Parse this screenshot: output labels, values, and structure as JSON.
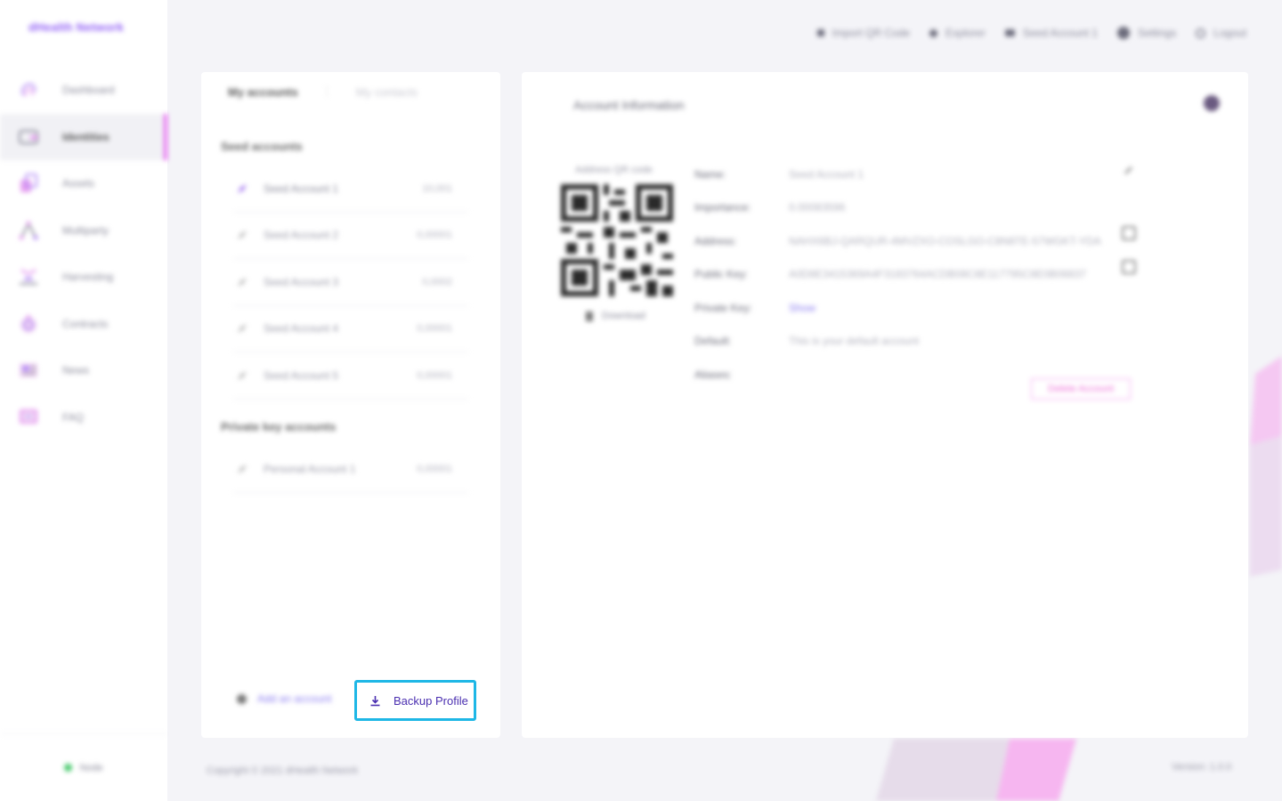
{
  "app": {
    "logo": "dHealth Network"
  },
  "sidebar": {
    "items": [
      {
        "label": "Dashboard",
        "icon": "fingerprint-icon",
        "active": false
      },
      {
        "label": "Identities",
        "icon": "wallet-icon",
        "active": true
      },
      {
        "label": "Assets",
        "icon": "assets-icon",
        "active": false
      },
      {
        "label": "Multiparty",
        "icon": "multiparty-icon",
        "active": false
      },
      {
        "label": "Harvesting",
        "icon": "harvesting-icon",
        "active": false
      },
      {
        "label": "Contracts",
        "icon": "contracts-icon",
        "active": false
      },
      {
        "label": "News",
        "icon": "news-icon",
        "active": false
      },
      {
        "label": "FAQ",
        "icon": "faq-icon",
        "active": false
      }
    ],
    "node_label": "Node"
  },
  "topbar": {
    "items": [
      {
        "label": "Import QR Code",
        "icon": "qr-import-icon"
      },
      {
        "label": "Explorer",
        "icon": "explorer-icon"
      },
      {
        "label": "Seed Account 1",
        "icon": "account-icon"
      },
      {
        "label": "Settings",
        "icon": "gear-icon"
      },
      {
        "label": "Logout",
        "icon": "logout-icon"
      }
    ]
  },
  "accounts": {
    "tab_active": "My accounts",
    "tab_separator": "⋮",
    "tab_inactive": "My contacts",
    "seed_title": "Seed accounts",
    "seed_accounts": [
      {
        "name": "Seed Account 1",
        "balance": "10,001"
      },
      {
        "name": "Seed Account 2",
        "balance": "0,00001"
      },
      {
        "name": "Seed Account 3",
        "balance": "0,0002"
      },
      {
        "name": "Seed Account 4",
        "balance": "0,00001"
      },
      {
        "name": "Seed Account 5",
        "balance": "0,00001"
      }
    ],
    "private_title": "Private key accounts",
    "private_accounts": [
      {
        "name": "Personal Account 1",
        "balance": "0,00001"
      }
    ],
    "add_account": "Add an account",
    "backup_profile": "Backup Profile"
  },
  "account_info": {
    "title": "Account Information",
    "qr_label": "Address QR code",
    "download": "Download",
    "fields": [
      {
        "label": "Name:",
        "value": "Seed Account 1"
      },
      {
        "label": "Importance:",
        "value": "0.00083596"
      },
      {
        "label": "Address:",
        "value": "NAHX6BJ-QARQUR-4MVZXO-COSLGO-C8N8TE-57WGKT-YDA"
      },
      {
        "label": "Public Key:",
        "value": "A0D8E3415369A4F3183764ACDB08C8E117795C8E0B06837"
      },
      {
        "label": "Private Key:",
        "value": "Show"
      },
      {
        "label": "Default:",
        "value": "This is your default account"
      },
      {
        "label": "Aliases:",
        "value": ""
      }
    ],
    "delete_account": "Delete Account"
  },
  "footer": {
    "copyright": "Copyright © 2021 dHealth Network",
    "version": "Version: 1.0.0"
  },
  "colors": {
    "brand": "#8f5cf5",
    "accent_pink": "#e56cf0",
    "highlight": "#1eb7e6",
    "button_text": "#4a2fb0",
    "node_online": "#45c86a"
  }
}
